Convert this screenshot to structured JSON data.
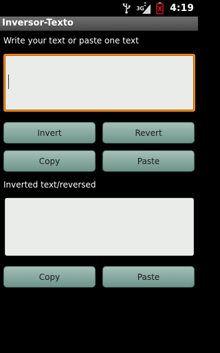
{
  "status_bar": {
    "network": "3G",
    "time": "4:19"
  },
  "app": {
    "title": "Inversor-Texto"
  },
  "input": {
    "label": "Write your text or paste one text",
    "value": ""
  },
  "buttons_row1": {
    "invert": "Invert",
    "revert": "Revert"
  },
  "buttons_row2": {
    "copy": "Copy",
    "paste": "Paste"
  },
  "output": {
    "label": "Inverted text/reversed",
    "value": ""
  },
  "buttons_row3": {
    "copy": "Copy",
    "paste": "Paste"
  },
  "colors": {
    "accent_focus": "#f08a12",
    "button": "#8aaaa2",
    "battery_alert": "#d81818"
  }
}
